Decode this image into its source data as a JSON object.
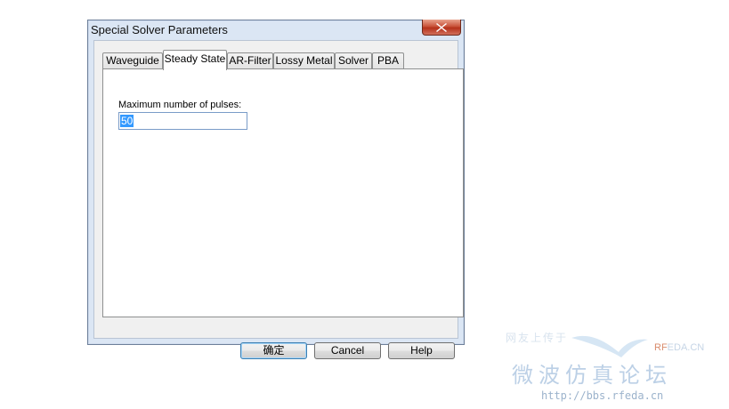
{
  "dialog": {
    "title": "Special Solver Parameters",
    "close_icon": "close-icon"
  },
  "tabs": [
    {
      "label": "Waveguide",
      "active": false
    },
    {
      "label": "Steady State",
      "active": true
    },
    {
      "label": "AR-Filter",
      "active": false
    },
    {
      "label": "Lossy Metal",
      "active": false
    },
    {
      "label": "Solver",
      "active": false
    },
    {
      "label": "PBA",
      "active": false
    }
  ],
  "panel": {
    "max_pulses_label": "Maximum number of pulses:",
    "max_pulses_value": "50"
  },
  "buttons": {
    "ok": "确定",
    "cancel": "Cancel",
    "help": "Help"
  },
  "watermark": {
    "note": "网友上传于",
    "brand_prefix": "RF",
    "brand_suffix": "EDA.CN",
    "chinese": "微波仿真论坛",
    "url": "http://bbs.rfeda.cn"
  },
  "colors": {
    "frame": "#dbe6f4",
    "close": "#c9533a",
    "selection": "#3399ff"
  }
}
